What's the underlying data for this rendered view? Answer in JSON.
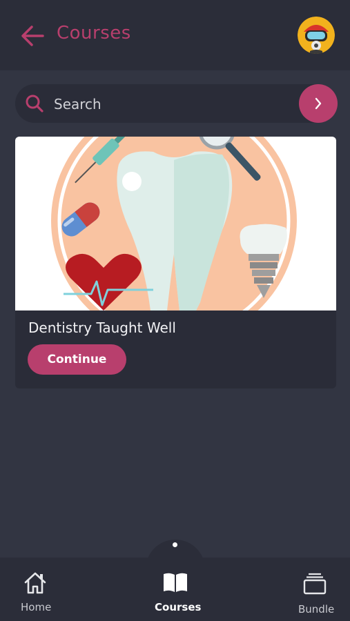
{
  "header": {
    "title": "Courses",
    "back_icon": "arrow-left-icon",
    "avatar_icon": "diver-avatar-icon",
    "accent_color": "#b83f6d"
  },
  "search": {
    "placeholder": "Search",
    "icon": "search-icon",
    "submit_icon": "chevron-right-icon"
  },
  "courses": [
    {
      "title": "Dentistry Taught Well",
      "action_label": "Continue",
      "image": "dentistry-illustration"
    }
  ],
  "bottom_nav": {
    "items": [
      {
        "label": "Home",
        "icon": "home-icon",
        "active": false
      },
      {
        "label": "Courses",
        "icon": "book-icon",
        "active": true
      },
      {
        "label": "Bundle",
        "icon": "bundle-icon",
        "active": false
      }
    ]
  }
}
